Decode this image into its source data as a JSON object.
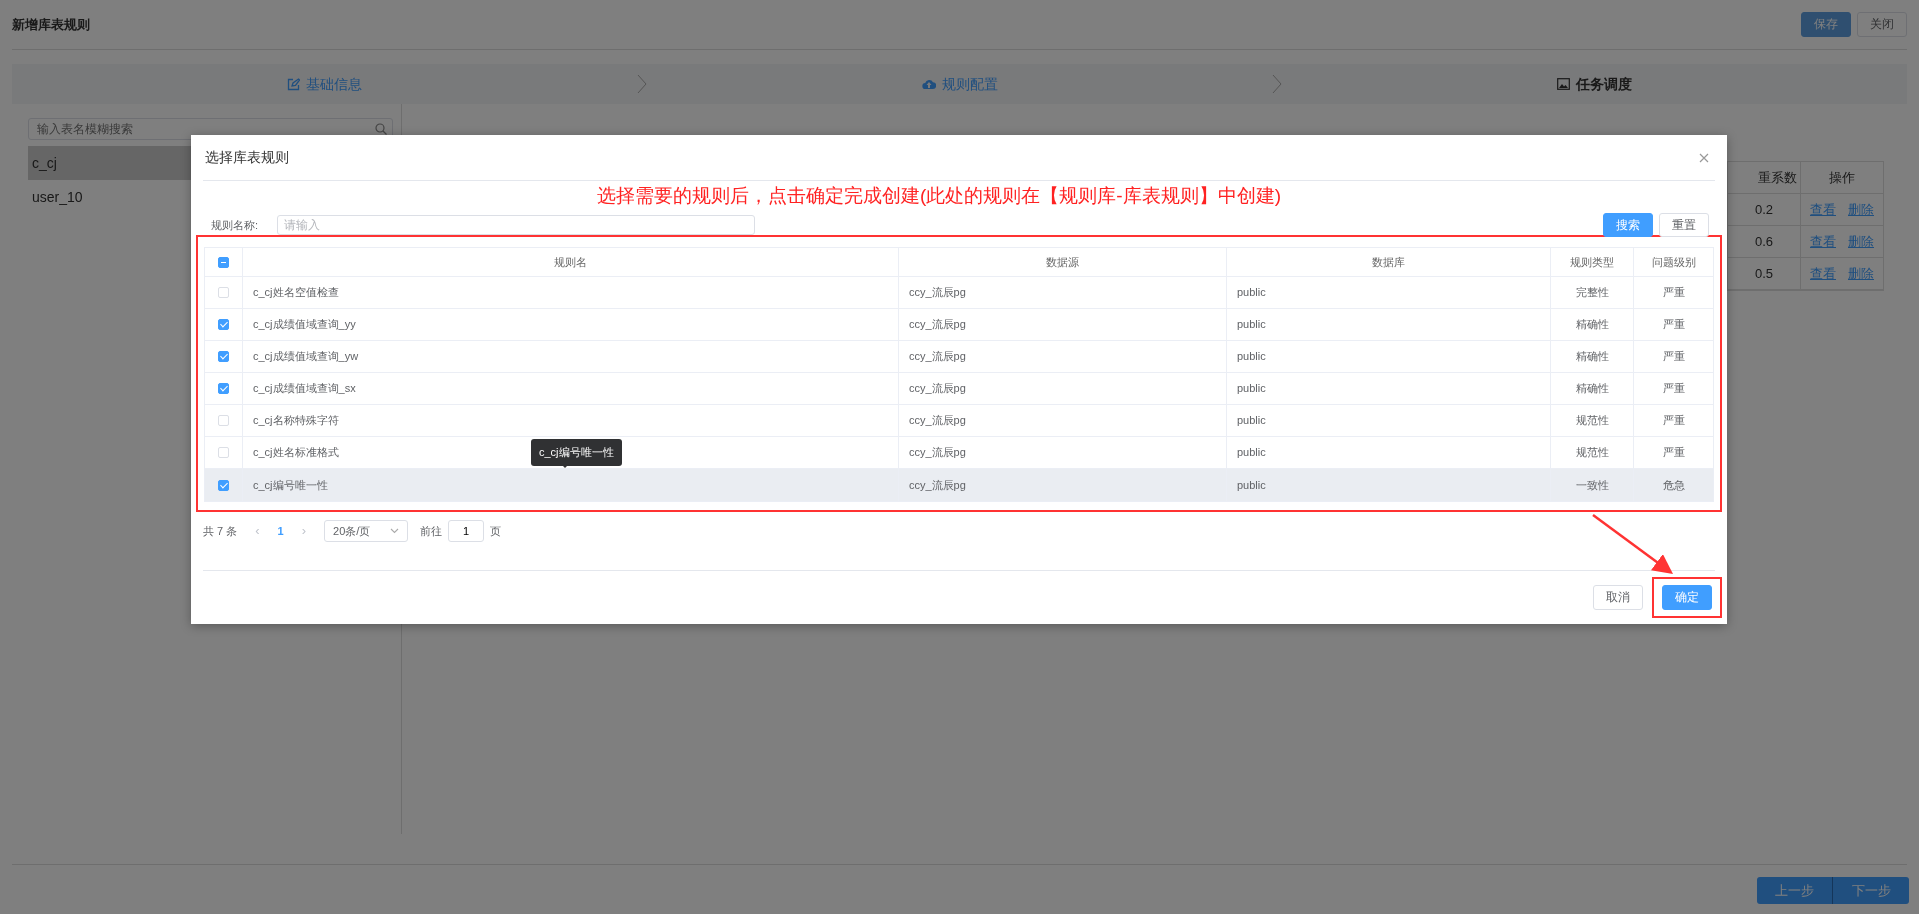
{
  "page": {
    "title": "新增库表规则",
    "buttons": [
      {
        "label": "保存",
        "kind": "primary",
        "disabled": true
      },
      {
        "label": "关闭",
        "kind": "default",
        "disabled": false
      }
    ]
  },
  "steps": [
    {
      "label": "基础信息",
      "kind": "edit",
      "done": true
    },
    {
      "label": "规则配置",
      "kind": "upload",
      "done": true
    },
    {
      "label": "任务调度",
      "kind": "schedule",
      "done": false
    }
  ],
  "sidebar": {
    "search_placeholder": "输入表名模糊搜索",
    "items": [
      {
        "label": "c_cj",
        "selected": true
      },
      {
        "label": "user_10",
        "selected": false
      }
    ]
  },
  "background_table": {
    "columns": [
      "重系数",
      "操作"
    ],
    "rows": [
      {
        "value": "0.2",
        "actions": [
          "查看",
          "删除"
        ]
      },
      {
        "value": "0.6",
        "actions": [
          "查看",
          "删除"
        ]
      },
      {
        "value": "0.5",
        "actions": [
          "查看",
          "删除"
        ]
      }
    ]
  },
  "nav_buttons": [
    {
      "label": "上一步",
      "kind": "prev"
    },
    {
      "label": "下一步",
      "kind": "next"
    }
  ],
  "dialog": {
    "title": "选择库表规则",
    "annotation": "选择需要的规则后，点击确定完成创建(此处的规则在【规则库-库表规则】中创建)",
    "filter": {
      "label": "规则名称:",
      "placeholder": "请输入"
    },
    "buttons": [
      {
        "label": "搜索",
        "kind": "primary"
      },
      {
        "label": "重置",
        "kind": "default"
      }
    ],
    "table": {
      "indeterminate": true,
      "columns": [
        "规则名",
        "数据源",
        "数据库",
        "规则类型",
        "问题级别"
      ],
      "rows": [
        {
          "checked": false,
          "hovered": false,
          "cells": [
            "c_cj姓名空值检查",
            "ccy_流辰pg",
            "public",
            "完整性",
            "严重"
          ]
        },
        {
          "checked": true,
          "hovered": false,
          "cells": [
            "c_cj成绩值域查询_yy",
            "ccy_流辰pg",
            "public",
            "精确性",
            "严重"
          ]
        },
        {
          "checked": true,
          "hovered": false,
          "cells": [
            "c_cj成绩值域查询_yw",
            "ccy_流辰pg",
            "public",
            "精确性",
            "严重"
          ]
        },
        {
          "checked": true,
          "hovered": false,
          "cells": [
            "c_cj成绩值域查询_sx",
            "ccy_流辰pg",
            "public",
            "精确性",
            "严重"
          ]
        },
        {
          "checked": false,
          "hovered": false,
          "cells": [
            "c_cj名称特殊字符",
            "ccy_流辰pg",
            "public",
            "规范性",
            "严重"
          ]
        },
        {
          "checked": false,
          "hovered": false,
          "cells": [
            "c_cj姓名标准格式",
            "ccy_流辰pg",
            "public",
            "规范性",
            "严重"
          ]
        },
        {
          "checked": true,
          "hovered": true,
          "cells": [
            "c_cj编号唯一性",
            "ccy_流辰pg",
            "public",
            "一致性",
            "危急"
          ]
        }
      ]
    },
    "tooltip": "c_cj编号唯一性",
    "pagination": {
      "total": "共 7 条",
      "prev": "‹",
      "pages": [
        {
          "label": "1",
          "selected": true
        }
      ],
      "next": "›",
      "page_size": "20条/页",
      "goto_label": "前往",
      "goto_value": "1",
      "page_suffix": "页"
    },
    "footer_buttons": [
      {
        "label": "取消",
        "kind": "default",
        "highlighted": false
      },
      {
        "label": "确定",
        "kind": "primary",
        "highlighted": true
      }
    ]
  }
}
